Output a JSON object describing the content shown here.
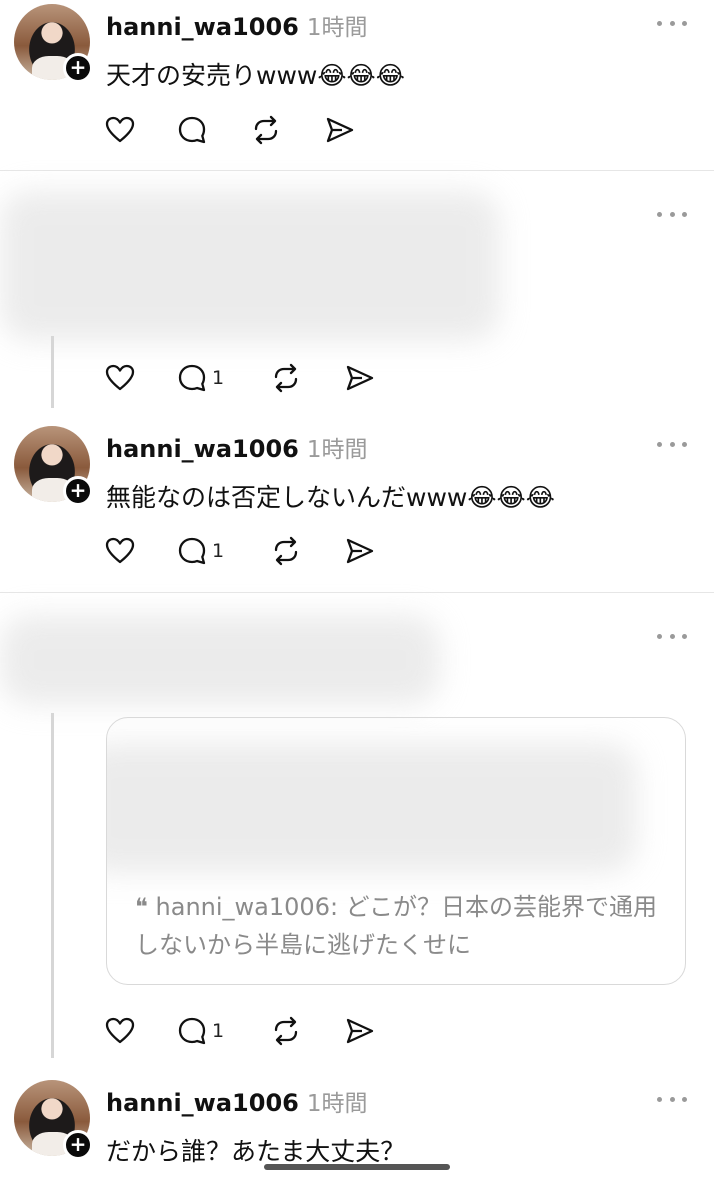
{
  "posts": [
    {
      "username": "hanni_wa1006",
      "time": "1時間",
      "text": "天才の安売りwww😂😂😂",
      "reply_count": ""
    },
    {
      "reply_count": "1"
    },
    {
      "username": "hanni_wa1006",
      "time": "1時間",
      "text": "無能なのは否定しないんだwww😂😂😂",
      "reply_count": "1"
    },
    {
      "quote": "❝ hanni_wa1006: どこが？日本の芸能界で通用しないから半島に逃げたくせに",
      "reply_count": "1"
    },
    {
      "username": "hanni_wa1006",
      "time": "1時間",
      "text": "だから誰？あたま大丈夫？"
    }
  ],
  "icons": {
    "like": "heart-icon",
    "reply": "comment-icon",
    "repost": "repost-icon",
    "share": "send-icon",
    "more": "more-dots-icon",
    "follow": "plus-icon"
  }
}
